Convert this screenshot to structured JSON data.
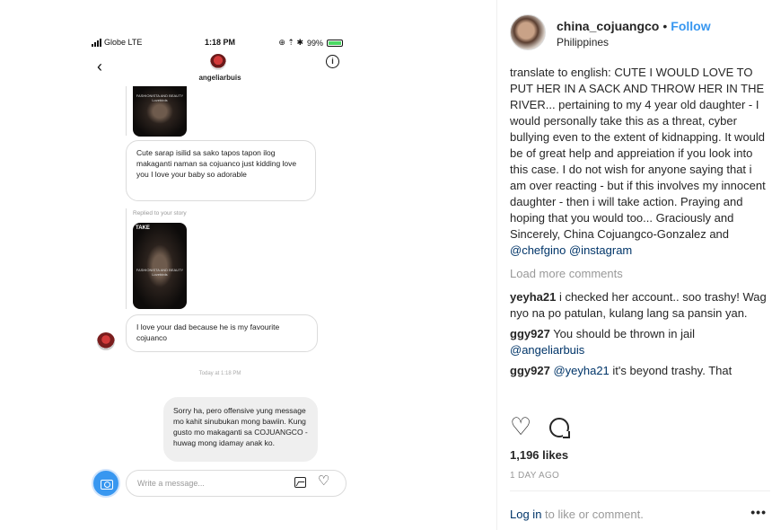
{
  "phone": {
    "status": {
      "carrier": "Globe  LTE",
      "time": "1:18 PM",
      "battery": "99%",
      "right_icons": "⊕ ⇡ ✱"
    },
    "nav": {
      "back_icon": "‹",
      "username": "angeliarbuis",
      "info_icon": "i"
    },
    "messages": {
      "story1_tag": "",
      "msg1": "Cute sarap isilid sa sako  tapos tapon ilog makaganti naman sa cojuanco just kidding love you I love your baby so adorable",
      "replied": "Replied to your story",
      "story2_tag": "TAKE",
      "story_caption": "FASHIONISTA AND BEAUTY Lovebirds",
      "msg2": "I love your dad because he is my favourite cojuanco",
      "today": "Today at 1:18 PM",
      "msg3": "Sorry ha, pero offensive yung message mo kahit sinubukan mong bawiin. Kung gusto mo makaganti sa COJUANGCO - huwag mong idamay anak ko."
    },
    "composer": {
      "placeholder": "Write a message..."
    }
  },
  "post": {
    "username": "china_cojuangco",
    "dot": "•",
    "follow": "Follow",
    "location": "Philippines",
    "caption_text": "translate to english: CUTE I WOULD LOVE TO PUT HER IN A SACK AND THROW HER IN THE RIVER... pertaining to my 4 year old daughter - I would personally take this as a threat, cyber bullying even to the extent of kidnapping. It would be of great help and appreiation if you look into this case. I do not wish for anyone saying that i am over reacting - but if this involves my innocent daughter - then i will take action. Praying and hoping that you would too... Graciously and Sincerely, China Cojuangco-Gonzalez and",
    "mention1": "@chefgino",
    "mention2": "@instagram",
    "load_more": "Load more comments",
    "comments": [
      {
        "user": "yeyha21",
        "text": "i checked her account.. soo trashy! Wag nyo na po patulan, kulang lang sa pansin yan."
      },
      {
        "user": "ggy927",
        "text": "You should be thrown in jail",
        "mention": "@angeliarbuis"
      },
      {
        "user": "ggy927",
        "mention": "@yeyha21",
        "text": "it's beyond trashy. That"
      }
    ],
    "likes": "1,196 likes",
    "date": "1 DAY AGO",
    "login_link": "Log in",
    "login_rest": " to like or comment.",
    "more": "•••"
  }
}
